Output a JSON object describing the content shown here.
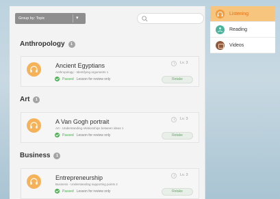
{
  "toolbar": {
    "group_by_label": "Group by:  Topic",
    "caret": "▾"
  },
  "sections": [
    {
      "name": "Anthropology",
      "count": "1",
      "lesson": {
        "title": "Ancient Egyptians",
        "subtitle": "Anthropology - Identifying arguments 1",
        "status": "Passed",
        "note": "Lesson for review only",
        "level": "Lv. 3",
        "action": "Retake"
      }
    },
    {
      "name": "Art",
      "count": "1",
      "lesson": {
        "title": "A Van Gogh portrait",
        "subtitle": "Art - Understanding relationships between ideas 1",
        "status": "Passed",
        "note": "Lesson for review only",
        "level": "Lv. 3",
        "action": "Retake"
      }
    },
    {
      "name": "Business",
      "count": "1",
      "lesson": {
        "title": "Entrepreneurship",
        "subtitle": "Business - Understanding supporting points 2",
        "status": "Passed",
        "note": "Lesson for review only",
        "level": "Lv. 3",
        "action": "Retake"
      }
    }
  ],
  "side_menu": {
    "items": [
      {
        "label": "Listening",
        "icon": "headphones-icon",
        "active": true
      },
      {
        "label": "Reading",
        "icon": "reading-icon",
        "active": false
      },
      {
        "label": "Videos",
        "icon": "video-icon",
        "active": false
      }
    ]
  }
}
